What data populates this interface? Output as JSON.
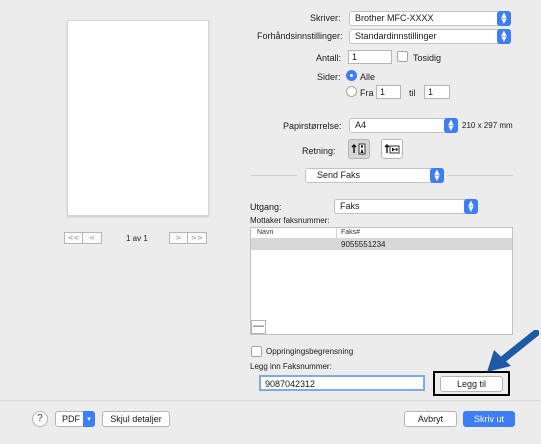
{
  "preview": {
    "pager_first": "<<",
    "pager_prev": "<",
    "pager_next": ">",
    "pager_last": ">>",
    "page_label": "1 av 1"
  },
  "printer": {
    "label": "Skriver:",
    "value": "Brother MFC-XXXX"
  },
  "presets": {
    "label": "Forhåndsinnstillinger:",
    "value": "Standardinnstillinger"
  },
  "copies": {
    "label": "Antall:",
    "value": "1",
    "duplex_label": "Tosidig"
  },
  "pages": {
    "label": "Sider:",
    "all_label": "Alle",
    "from_label": "Fra",
    "from_value": "1",
    "to_label": "til",
    "to_value": "1"
  },
  "paper": {
    "label": "Papirstørrelse:",
    "value": "A4",
    "dims": "210 x 297 mm"
  },
  "orientation": {
    "label": "Retning:"
  },
  "section": {
    "value": "Send Faks"
  },
  "output": {
    "label": "Utgang:",
    "value": "Faks"
  },
  "recipients": {
    "label": "Mottaker faksnummer:",
    "columns": [
      "Navn",
      "Faks#"
    ],
    "rows": [
      {
        "name": "",
        "fax": "9055551234"
      }
    ]
  },
  "minus_label": "—",
  "dial_limit": {
    "label": "Oppringingsbegrensning"
  },
  "fax_input": {
    "label": "Legg inn Faksnummer:",
    "value": "9087042312"
  },
  "add_button": "Legg til",
  "footer": {
    "help": "?",
    "pdf": "PDF",
    "hide_details": "Skjul detaljer",
    "cancel": "Avbryt",
    "print": "Skriv ut"
  },
  "colors": {
    "accent": "#3d7df6",
    "callout_arrow": "#1f5aa6"
  }
}
